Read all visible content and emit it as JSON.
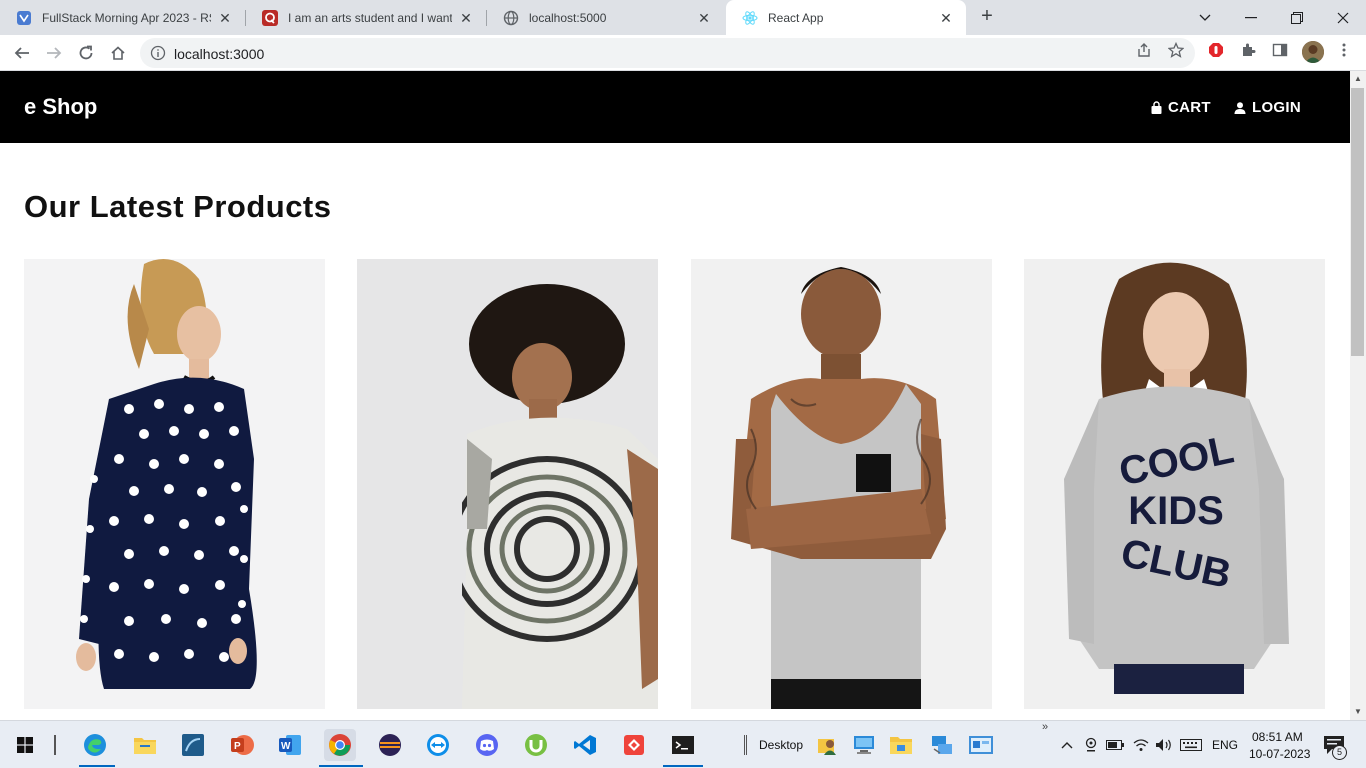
{
  "browser": {
    "tabs": [
      {
        "title": "FullStack Morning Apr 2023 - RST",
        "close": "✕"
      },
      {
        "title": "I am an arts student and I want to",
        "close": "✕"
      },
      {
        "title": "localhost:5000",
        "close": "✕"
      },
      {
        "title": "React App",
        "close": "✕"
      }
    ],
    "new_tab": "+",
    "url": "localhost:3000"
  },
  "page": {
    "brand": "e Shop",
    "nav": {
      "cart": "CART",
      "login": "LOGIN"
    },
    "section_title": "Our Latest Products",
    "products": [
      {
        "alt": "Woman in navy polka dot dress"
      },
      {
        "alt": "Man in tie-dye t-shirt"
      },
      {
        "alt": "Man in grey tank top"
      },
      {
        "alt": "Woman in grey COOL KIDS CLUB sweatshirt",
        "print": [
          "COOL",
          "KIDS",
          "CLUB"
        ]
      }
    ]
  },
  "taskbar": {
    "desktop_label": "Desktop",
    "language": "ENG",
    "time": "08:51 AM",
    "date": "10-07-2023",
    "notification_count": "5",
    "overflow": "»"
  },
  "colors": {
    "navbar_bg": "#000000",
    "chrome_bg": "#dee1e6",
    "taskbar_bg": "#e8edf4",
    "accent": "#0067c0"
  }
}
